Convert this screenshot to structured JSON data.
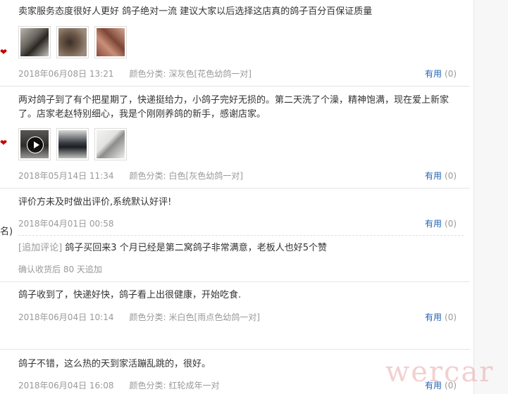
{
  "side": {
    "marks": [
      "❤",
      "❤"
    ],
    "text": "名)"
  },
  "reviews": [
    {
      "content": "卖家服务态度很好人更好 鸽子绝对一流 建议大家以后选择这店真的鸽子百分百保证质量",
      "date": "2018年06月08日 13:21",
      "category_label": "颜色分类:",
      "category": "深灰色[花色幼鸽一对]",
      "useful_label": "有用",
      "useful_count": "(0)"
    },
    {
      "content": "两对鸽子到了有个把星期了，快递挺给力，小鸽子完好无损的。第二天洗了个澡，精神饱满，现在爱上新家了。店家老赵特别细心，我是个刚刚养鸽的新手，感谢店家。",
      "date": "2018年05月14日 11:34",
      "category_label": "颜色分类:",
      "category": "白色[灰色幼鸽一对]",
      "useful_label": "有用",
      "useful_count": "(0)"
    },
    {
      "content": "评价方未及时做出评价,系统默认好评!",
      "date": "2018年04月01日 00:58",
      "useful_label": "有用",
      "useful_count": "(0)",
      "append_tag": "[追加评论]",
      "append_text": "鸽子买回来3 个月已经是第二窝鸽子非常满意，老板人也好5个赞",
      "append_note": "确认收货后 80 天追加"
    },
    {
      "content": "鸽子收到了，快递好快，鸽子看上出很健康，开始吃食.",
      "date": "2018年06月04日 10:14",
      "category_label": "颜色分类:",
      "category": "米白色[雨点色幼鸽一对]",
      "useful_label": "有用",
      "useful_count": "(0)"
    },
    {
      "content": "鸽子不错，这么热的天到家活蹦乱跳的，很好。",
      "date": "2018年06月04日 16:08",
      "category_label": "颜色分类:",
      "category": "红轮成年一对",
      "useful_label": "有用",
      "useful_count": "(0)"
    }
  ],
  "watermark": "wercar"
}
